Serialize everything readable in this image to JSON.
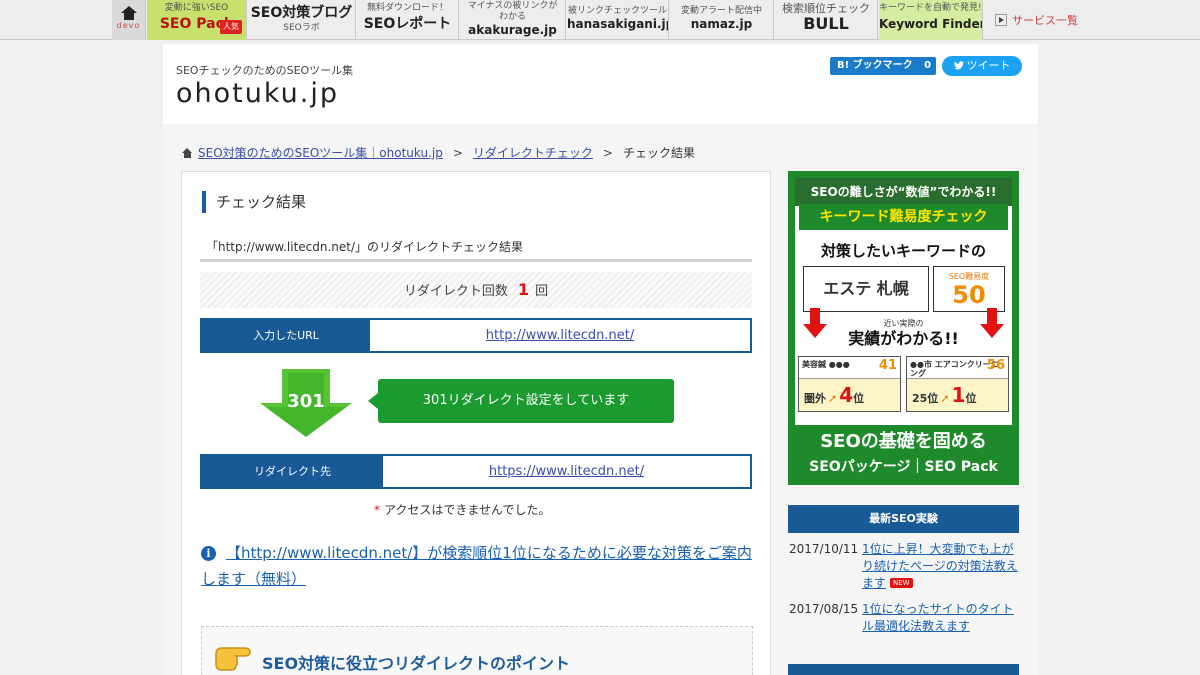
{
  "topnav": {
    "home": {
      "label": "devo"
    },
    "items": [
      {
        "sub": "変動に強いSEO",
        "title": "SEO Pack",
        "badge": "人気"
      },
      {
        "title": "SEO対策ブログ",
        "sub": "SEOラボ"
      },
      {
        "sub": "無料ダウンロード！",
        "title": "SEOレポート"
      },
      {
        "sub": "マイナスの被リンクが",
        "sub2": "わかる",
        "title": "akakurage.jp"
      },
      {
        "sub": "被リンクチェックツール",
        "title": "hanasakigani.jp"
      },
      {
        "sub": "変動アラート配信中",
        "title": "namaz.jp"
      },
      {
        "sub": "検索順位チェック",
        "title": "BULL"
      },
      {
        "sub": "キーワードを自動で発見!!",
        "title": "Keyword Finder"
      }
    ],
    "services": "サービス一覧"
  },
  "header": {
    "tagline": "SEOチェックのためのSEOツール集",
    "logo": "ohotuku.jp",
    "bookmark": "B! ブックマーク",
    "bookmark_count": "0",
    "tweet": "ツイート"
  },
  "breadcrumb": {
    "home": "SEO対策のためのSEOツール集｜ohotuku.jp",
    "check": "リダイレクトチェック",
    "current": "チェック結果"
  },
  "result": {
    "section_title": "チェック結果",
    "result_title": "「http://www.litecdn.net/」のリダイレクトチェック結果",
    "count_label": "リダイレクト回数",
    "count_value": "1",
    "count_unit": "回",
    "input_label": "入力したURL",
    "input_url": "http://www.litecdn.net/",
    "status_code": "301",
    "status_message": "301リダイレクト設定をしています",
    "dest_label": "リダイレクト先",
    "dest_url": "https://www.litecdn.net/",
    "note_mark": "*",
    "note": "アクセスはできませんでした。",
    "guide_link": "【http://www.litecdn.net/】が検索順位1位になるために必要な対策をご案内します（無料）",
    "points_title": "SEO対策に役立つリダイレクトのポイント"
  },
  "ad": {
    "headline": "SEOの難しさが“数値”でわかる!!",
    "title": "キーワード難易度チェック",
    "lead": "対策したいキーワードの",
    "keyword": "エステ 札幌",
    "score_label": "SEO難易度",
    "score": "50",
    "result_small": "近い実際の",
    "result_big": "実績がわかる!!",
    "cases": [
      {
        "name": "美容鍼 ●●●",
        "score": "41",
        "from": "圏外",
        "to": "4",
        "unit": "位"
      },
      {
        "name": "●●市 エアコンクリーニング",
        "score": "56",
        "from": "25位",
        "to": "1",
        "unit": "位"
      }
    ],
    "bottom_title": "SEOの基礎を固める",
    "bottom_sub": "SEOパッケージ｜SEO Pack"
  },
  "news": {
    "heading": "最新SEO実験",
    "items": [
      {
        "date": "2017/10/11",
        "title": "1位に上昇！大変動でも上がり続けたページの対策法教えます",
        "badge": "NEW"
      },
      {
        "date": "2017/08/15",
        "title": "1位になったサイトのタイトル最適化法教えます"
      }
    ]
  },
  "colors": {
    "accent_blue": "#195a96",
    "accent_green": "#1b9a2f",
    "count_red": "#d11111"
  }
}
